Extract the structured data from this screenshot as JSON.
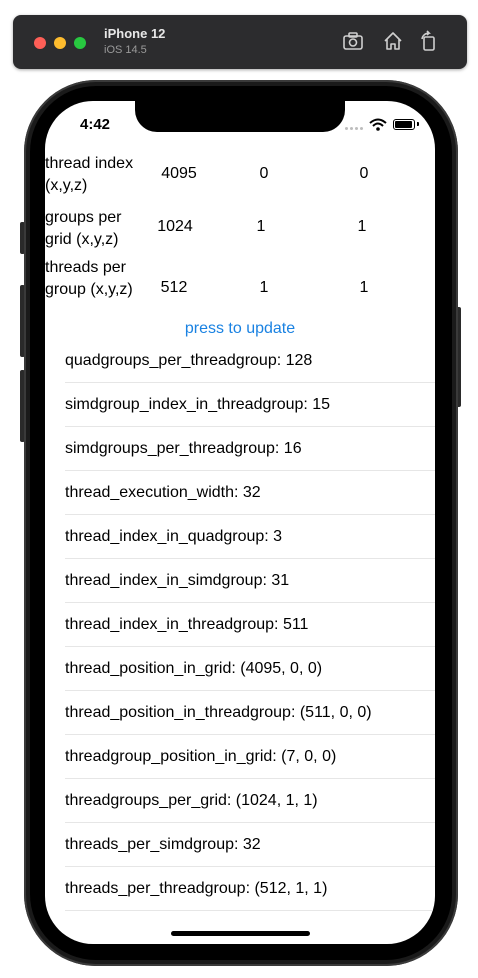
{
  "simulator": {
    "device_name": "iPhone 12",
    "os_version": "iOS 14.5"
  },
  "status_bar": {
    "time": "4:42"
  },
  "grid_table": {
    "rows": [
      {
        "label": "thread index (x,y,z)",
        "x": "4095",
        "y": "0",
        "z": "0"
      },
      {
        "label": "groups per grid (x,y,z)",
        "x": "1024",
        "y": "1",
        "z": "1"
      },
      {
        "label": "threads per group (x,y,z)",
        "x": "512",
        "y": "1",
        "z": "1"
      }
    ]
  },
  "update_button_label": "press to update",
  "attributes": [
    "quadgroups_per_threadgroup: 128",
    "simdgroup_index_in_threadgroup: 15",
    "simdgroups_per_threadgroup: 16",
    "thread_execution_width: 32",
    "thread_index_in_quadgroup: 3",
    "thread_index_in_simdgroup: 31",
    "thread_index_in_threadgroup: 511",
    "thread_position_in_grid: (4095, 0, 0)",
    "thread_position_in_threadgroup: (511, 0, 0)",
    "threadgroup_position_in_grid: (7, 0, 0)",
    "threadgroups_per_grid: (1024, 1, 1)",
    "threads_per_simdgroup: 32",
    "threads_per_threadgroup: (512, 1, 1)"
  ],
  "colors": {
    "link_blue": "#1a82e2",
    "separator": "#e6e6e6"
  }
}
